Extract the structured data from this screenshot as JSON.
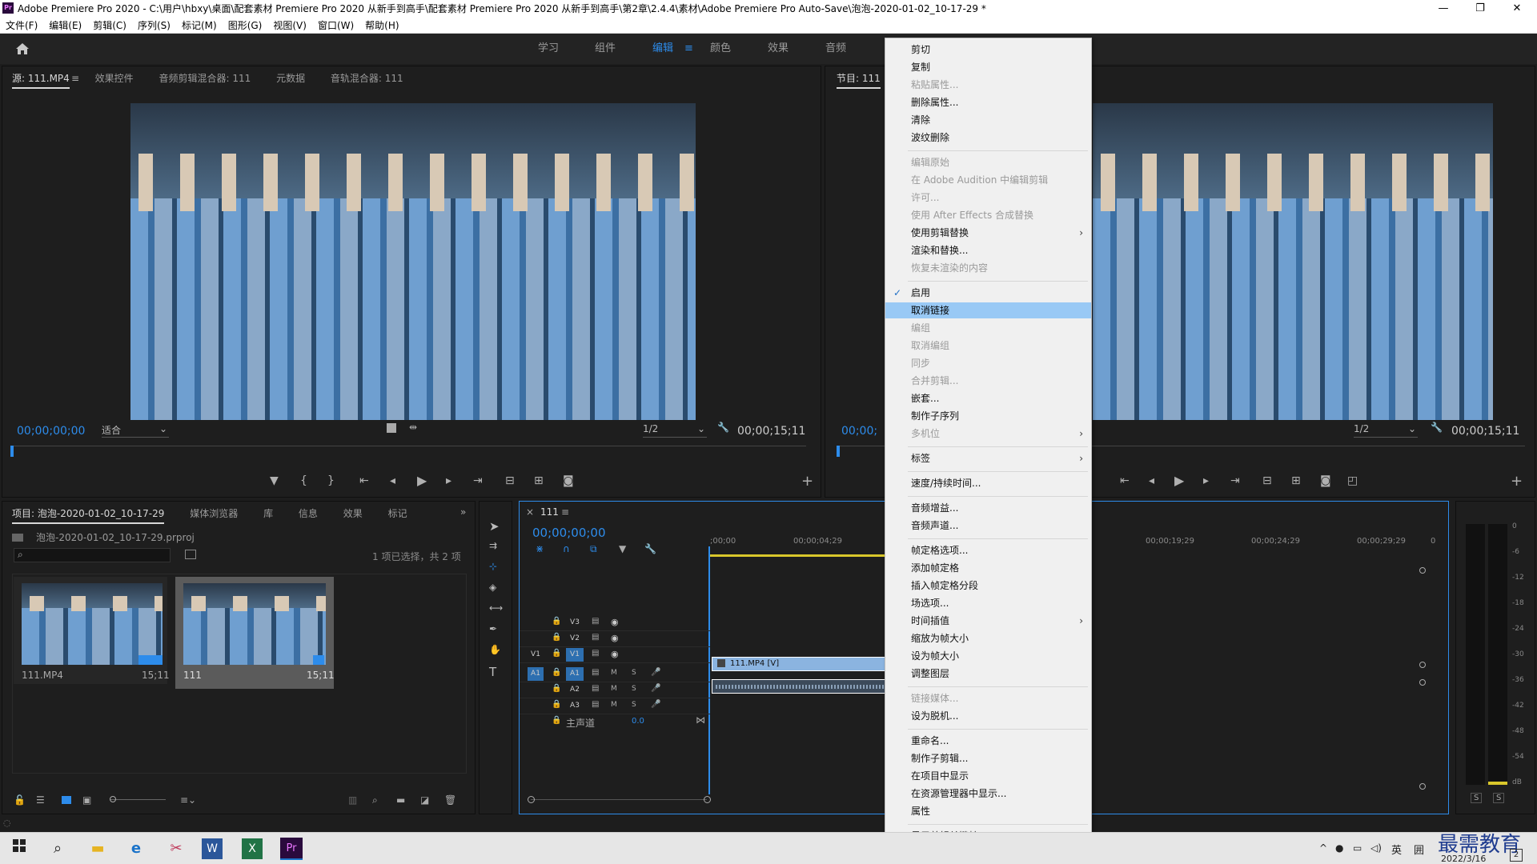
{
  "window": {
    "title": "Adobe Premiere Pro 2020 - C:\\用户\\hbxy\\桌面\\配套素材 Premiere Pro 2020 从新手到高手\\配套素材 Premiere Pro 2020 从新手到高手\\第2章\\2.4.4\\素材\\Adobe Premiere Pro Auto-Save\\泡泡-2020-01-02_10-17-29 *",
    "logo": "Pr",
    "minimize": "—",
    "restore": "❐",
    "close": "✕"
  },
  "menubar": [
    "文件(F)",
    "编辑(E)",
    "剪辑(C)",
    "序列(S)",
    "标记(M)",
    "图形(G)",
    "视图(V)",
    "窗口(W)",
    "帮助(H)"
  ],
  "workspaces": {
    "home_icon": "home-icon",
    "tabs": [
      "学习",
      "组件",
      "编辑",
      "颜色",
      "效果",
      "音频"
    ],
    "active": "编辑",
    "menu_glyph": "≡"
  },
  "source_panel": {
    "tabs": [
      "源: 111.MP4",
      "效果控件",
      "音频剪辑混合器: 111",
      "元数据",
      "音轨混合器: 111"
    ],
    "menu_glyph": "≡",
    "timecode": "00;00;00;00",
    "fit": "适合",
    "resolution": "1/2",
    "duration": "00;00;15;11"
  },
  "program_panel": {
    "title": "节目: 111",
    "timecode": "00;00;",
    "resolution": "1/2",
    "duration": "00;00;15;11"
  },
  "project_panel": {
    "tabs": [
      "项目: 泡泡-2020-01-02_10-17-29",
      "媒体浏览器",
      "库",
      "信息",
      "效果",
      "标记"
    ],
    "more": "»",
    "file": "泡泡-2020-01-02_10-17-29.prproj",
    "search_icon": "⌕",
    "selection": "1 项已选择，共 2 项",
    "items": [
      {
        "name": "111.MP4",
        "dur": "15;11"
      },
      {
        "name": "111",
        "dur": "15;11"
      }
    ]
  },
  "timeline": {
    "tab": "111",
    "close": "×",
    "timecode": "00;00;00;00",
    "ruler": [
      ";00;00",
      "00;00;04;29",
      "00;00;19;29",
      "00;00;24;29",
      "00;00;29;29",
      "0"
    ],
    "tracks": [
      {
        "name": "V3"
      },
      {
        "name": "V2"
      },
      {
        "name": "V1",
        "src": "V1"
      },
      {
        "name": "A1",
        "src": "A1"
      },
      {
        "name": "A2"
      },
      {
        "name": "A3"
      }
    ],
    "master": "主声道",
    "master_val": "0.0",
    "clip_video": "111.MP4 [V]",
    "m": "M",
    "s": "S"
  },
  "meter": {
    "labels": [
      "0",
      "-6",
      "-12",
      "-18",
      "-24",
      "-30",
      "-36",
      "-42",
      "-48",
      "-54",
      "dB"
    ],
    "s1": "S",
    "s2": "S"
  },
  "context_menu": [
    {
      "label": "剪切",
      "state": "normal"
    },
    {
      "label": "复制",
      "state": "normal"
    },
    {
      "label": "粘贴属性...",
      "state": "disabled"
    },
    {
      "label": "删除属性...",
      "state": "normal"
    },
    {
      "label": "清除",
      "state": "normal"
    },
    {
      "label": "波纹删除",
      "state": "normal"
    },
    {
      "sep": true
    },
    {
      "label": "编辑原始",
      "state": "disabled"
    },
    {
      "label": "在 Adobe Audition 中编辑剪辑",
      "state": "disabled"
    },
    {
      "label": "许可...",
      "state": "disabled"
    },
    {
      "label": "使用 After Effects 合成替换",
      "state": "disabled"
    },
    {
      "label": "使用剪辑替换",
      "state": "normal",
      "sub": true
    },
    {
      "label": "渲染和替换...",
      "state": "normal"
    },
    {
      "label": "恢复未渲染的内容",
      "state": "disabled"
    },
    {
      "sep": true
    },
    {
      "label": "启用",
      "state": "normal",
      "check": true
    },
    {
      "label": "取消链接",
      "state": "highlight"
    },
    {
      "label": "编组",
      "state": "disabled"
    },
    {
      "label": "取消编组",
      "state": "disabled"
    },
    {
      "label": "同步",
      "state": "disabled"
    },
    {
      "label": "合并剪辑...",
      "state": "disabled"
    },
    {
      "label": "嵌套...",
      "state": "normal"
    },
    {
      "label": "制作子序列",
      "state": "normal"
    },
    {
      "label": "多机位",
      "state": "disabled",
      "sub": true
    },
    {
      "sep": true
    },
    {
      "label": "标签",
      "state": "normal",
      "sub": true
    },
    {
      "sep": true
    },
    {
      "label": "速度/持续时间...",
      "state": "normal"
    },
    {
      "sep": true
    },
    {
      "label": "音频增益...",
      "state": "normal"
    },
    {
      "label": "音频声道...",
      "state": "normal"
    },
    {
      "sep": true
    },
    {
      "label": "帧定格选项...",
      "state": "normal"
    },
    {
      "label": "添加帧定格",
      "state": "normal"
    },
    {
      "label": "插入帧定格分段",
      "state": "normal"
    },
    {
      "label": "场选项...",
      "state": "normal"
    },
    {
      "label": "时间插值",
      "state": "normal",
      "sub": true
    },
    {
      "label": "缩放为帧大小",
      "state": "normal"
    },
    {
      "label": "设为帧大小",
      "state": "normal"
    },
    {
      "label": "调整图层",
      "state": "normal"
    },
    {
      "sep": true
    },
    {
      "label": "链接媒体...",
      "state": "disabled"
    },
    {
      "label": "设为脱机...",
      "state": "normal"
    },
    {
      "sep": true
    },
    {
      "label": "重命名...",
      "state": "normal"
    },
    {
      "label": "制作子剪辑...",
      "state": "normal"
    },
    {
      "label": "在项目中显示",
      "state": "normal"
    },
    {
      "label": "在资源管理器中显示...",
      "state": "normal"
    },
    {
      "label": "属性",
      "state": "normal"
    },
    {
      "sep": true
    },
    {
      "label": "显示剪辑关键帧",
      "state": "normal",
      "sub": true
    }
  ],
  "taskbar": {
    "apps": [
      "windows-icon",
      "search-icon",
      "file-explorer-icon",
      "edge-icon",
      "snipping-icon",
      "word-icon",
      "excel-icon",
      "premiere-icon"
    ],
    "lang": "英",
    "ime": "囲",
    "date": "2022/3/16",
    "watermark": "最需教育",
    "notif": "2"
  }
}
